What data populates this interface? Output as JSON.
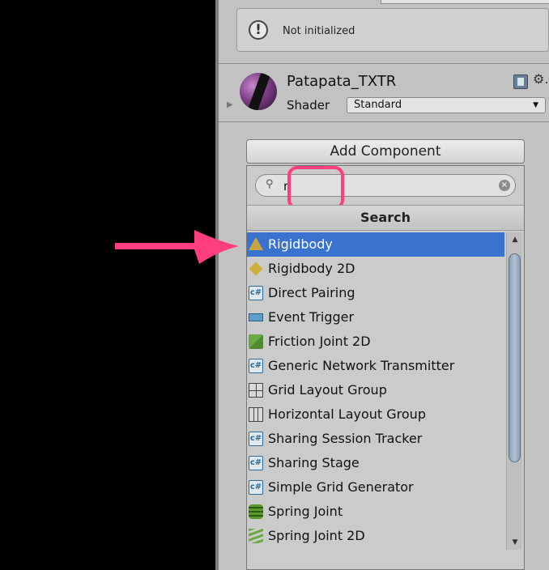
{
  "status": {
    "text": "Not initialized"
  },
  "material": {
    "name": "Patapata_TXTR",
    "shader_label": "Shader",
    "shader_value": "Standard"
  },
  "add_component": {
    "button_label": "Add Component",
    "search_value": "ri",
    "search_header": "Search"
  },
  "results": [
    {
      "label": "Rigidbody",
      "icon": "rigidbody-icon",
      "selected": true
    },
    {
      "label": "Rigidbody 2D",
      "icon": "rigidbody2d-icon"
    },
    {
      "label": "Direct Pairing",
      "icon": "script-icon"
    },
    {
      "label": "Event Trigger",
      "icon": "event-trigger-icon"
    },
    {
      "label": "Friction Joint 2D",
      "icon": "friction-joint-icon"
    },
    {
      "label": "Generic Network Transmitter",
      "icon": "script-icon"
    },
    {
      "label": "Grid Layout Group",
      "icon": "grid-layout-icon"
    },
    {
      "label": "Horizontal Layout Group",
      "icon": "horizontal-layout-icon"
    },
    {
      "label": "Sharing Session Tracker",
      "icon": "script-icon"
    },
    {
      "label": "Sharing Stage",
      "icon": "script-icon"
    },
    {
      "label": "Simple Grid Generator",
      "icon": "script-icon"
    },
    {
      "label": "Spring Joint",
      "icon": "spring-joint-icon"
    },
    {
      "label": "Spring Joint 2D",
      "icon": "spring-joint-2d-icon"
    }
  ],
  "colors": {
    "highlight": "#ff3e7e",
    "selection": "#3a72d0",
    "panel": "#c2c2c2"
  }
}
